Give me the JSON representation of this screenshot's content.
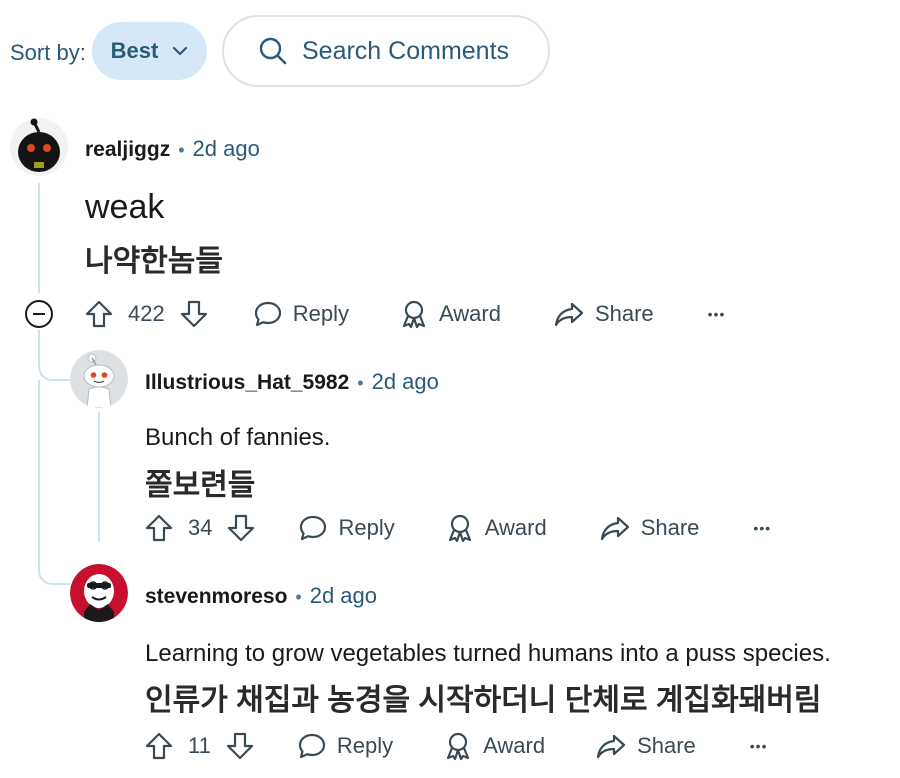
{
  "toolbar": {
    "sort_label": "Sort by:",
    "sort_value": "Best",
    "search_placeholder": "Search Comments"
  },
  "comments": [
    {
      "user": "realjiggz",
      "separator": "•",
      "time": "2d ago",
      "body": "weak",
      "translation": "나약한놈들",
      "votes": "422",
      "reply": "Reply",
      "award": "Award",
      "share": "Share",
      "more": "•••"
    },
    {
      "user": "Illustrious_Hat_5982",
      "separator": "•",
      "time": "2d ago",
      "body": "Bunch of fannies.",
      "translation": "쫄보련들",
      "votes": "34",
      "reply": "Reply",
      "award": "Award",
      "share": "Share",
      "more": "•••"
    },
    {
      "user": "stevenmoreso",
      "separator": "•",
      "time": "2d ago",
      "body": "Learning to grow vegetables turned humans into a puss species.",
      "translation": "인류가 채집과 농경을 시작하더니 단체로 계집화돼버림",
      "votes": "11",
      "reply": "Reply",
      "award": "Award",
      "share": "Share",
      "more": "•••"
    }
  ]
}
